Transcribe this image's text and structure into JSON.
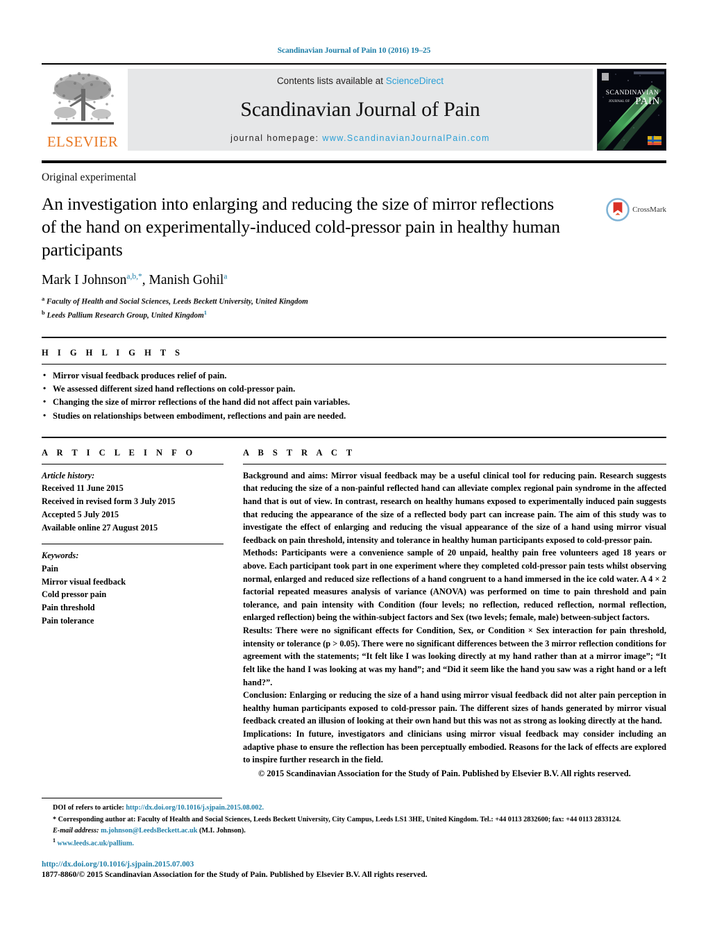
{
  "running_head": "Scandinavian Journal of Pain 10 (2016) 19–25",
  "masthead": {
    "publisher_name": "ELSEVIER",
    "contents_prefix": "Contents lists available at ",
    "contents_link": "ScienceDirect",
    "journal_title": "Scandinavian Journal of Pain",
    "homepage_prefix": "journal homepage: ",
    "homepage_url": "www.ScandinavianJournalPain.com",
    "cover_title_line1": "SCANDINAVIAN",
    "cover_title_line2": "JOURNAL OF",
    "cover_title_line3": "PAIN"
  },
  "article": {
    "type": "Original experimental",
    "title": "An investigation into enlarging and reducing the size of mirror reflections of the hand on experimentally-induced cold-pressor pain in healthy human participants",
    "crossmark_label": "CrossMark",
    "authors_html": "Mark I Johnson<sup>a,b,</sup><sup class=\"star\">*</sup>, Manish Gohil<sup>a</sup>",
    "affiliation_a": "Faculty of Health and Social Sciences, Leeds Beckett University, United Kingdom",
    "affiliation_b": "Leeds Pallium Research Group, United Kingdom"
  },
  "highlights": {
    "heading": "H I G H L I G H T S",
    "items": [
      "Mirror visual feedback produces relief of pain.",
      "We assessed different sized hand reflections on cold-pressor pain.",
      "Changing the size of mirror reflections of the hand did not affect pain variables.",
      "Studies on relationships between embodiment, reflections and pain are needed."
    ]
  },
  "article_info": {
    "heading": "A R T I C L E   I N F O",
    "history_label": "Article history:",
    "history": [
      "Received 11 June 2015",
      "Received in revised form 3 July 2015",
      "Accepted 5 July 2015",
      "Available online 27 August 2015"
    ],
    "keywords_label": "Keywords:",
    "keywords": [
      "Pain",
      "Mirror visual feedback",
      "Cold pressor pain",
      "Pain threshold",
      "Pain tolerance"
    ]
  },
  "abstract": {
    "heading": "A B S T R A C T",
    "background_label": "Background and aims:",
    "background_text": " Mirror visual feedback may be a useful clinical tool for reducing pain. Research suggests that reducing the size of a non-painful reflected hand can alleviate complex regional pain syndrome in the affected hand that is out of view. In contrast, research on healthy humans exposed to experimentally induced pain suggests that reducing the appearance of the size of a reflected body part can increase pain. The aim of this study was to investigate the effect of enlarging and reducing the visual appearance of the size of a hand using mirror visual feedback on pain threshold, intensity and tolerance in healthy human participants exposed to cold-pressor pain.",
    "methods_label": "Methods:",
    "methods_text": " Participants were a convenience sample of 20 unpaid, healthy pain free volunteers aged 18 years or above. Each participant took part in one experiment where they completed cold-pressor pain tests whilst observing normal, enlarged and reduced size reflections of a hand congruent to a hand immersed in the ice cold water. A 4 × 2 factorial repeated measures analysis of variance (ANOVA) was performed on time to pain threshold and pain tolerance, and pain intensity with Condition (four levels; no reflection, reduced reflection, normal reflection, enlarged reflection) being the within-subject factors and Sex (two levels; female, male) between-subject factors.",
    "results_label": "Results:",
    "results_text": " There were no significant effects for Condition, Sex, or Condition × Sex interaction for pain threshold, intensity or tolerance (p > 0.05). There were no significant differences between the 3 mirror reflection conditions for agreement with the statements; “It felt like I was looking directly at my hand rather than at a mirror image”; “It felt like the hand I was looking at was my hand”; and “Did it seem like the hand you saw was a right hand or a left hand?”.",
    "conclusion_label": "Conclusion:",
    "conclusion_text": " Enlarging or reducing the size of a hand using mirror visual feedback did not alter pain perception in healthy human participants exposed to cold-pressor pain. The different sizes of hands generated by mirror visual feedback created an illusion of looking at their own hand but this was not as strong as looking directly at the hand.",
    "implications_label": "Implications:",
    "implications_text": " In future, investigators and clinicians using mirror visual feedback may consider including an adaptive phase to ensure the reflection has been perceptually embodied. Reasons for the lack of effects are explored to inspire further research in the field.",
    "copyright": "© 2015 Scandinavian Association for the Study of Pain. Published by Elsevier B.V. All rights reserved."
  },
  "footnotes": {
    "doi_refers_label": "DOI of refers to article: ",
    "doi_refers_url": "http://dx.doi.org/10.1016/j.sjpain.2015.08.002.",
    "corresponding_marker": "*",
    "corresponding_text": " Corresponding author at: Faculty of Health and Social Sciences, Leeds Beckett University, City Campus, Leeds LS1 3HE, United Kingdom. Tel.: +44 0113 2832600; fax: +44 0113 2833124.",
    "email_label": "E-mail address:",
    "email_address": " m.johnson@LeedsBeckett.ac.uk",
    "email_suffix": " (M.I. Johnson).",
    "note_marker": "1",
    "note_url": " www.leeds.ac.uk/pallium."
  },
  "bottom": {
    "doi_url": "http://dx.doi.org/10.1016/j.sjpain.2015.07.003",
    "issn_line": "1877-8860/© 2015 Scandinavian Association for the Study of Pain. Published by Elsevier B.V. All rights reserved."
  },
  "colors": {
    "link_blue": "#1f7fa8",
    "sciencedirect_blue": "#2a9fd6",
    "elsevier_orange": "#e87722",
    "band_gray": "#e6e7e8"
  }
}
